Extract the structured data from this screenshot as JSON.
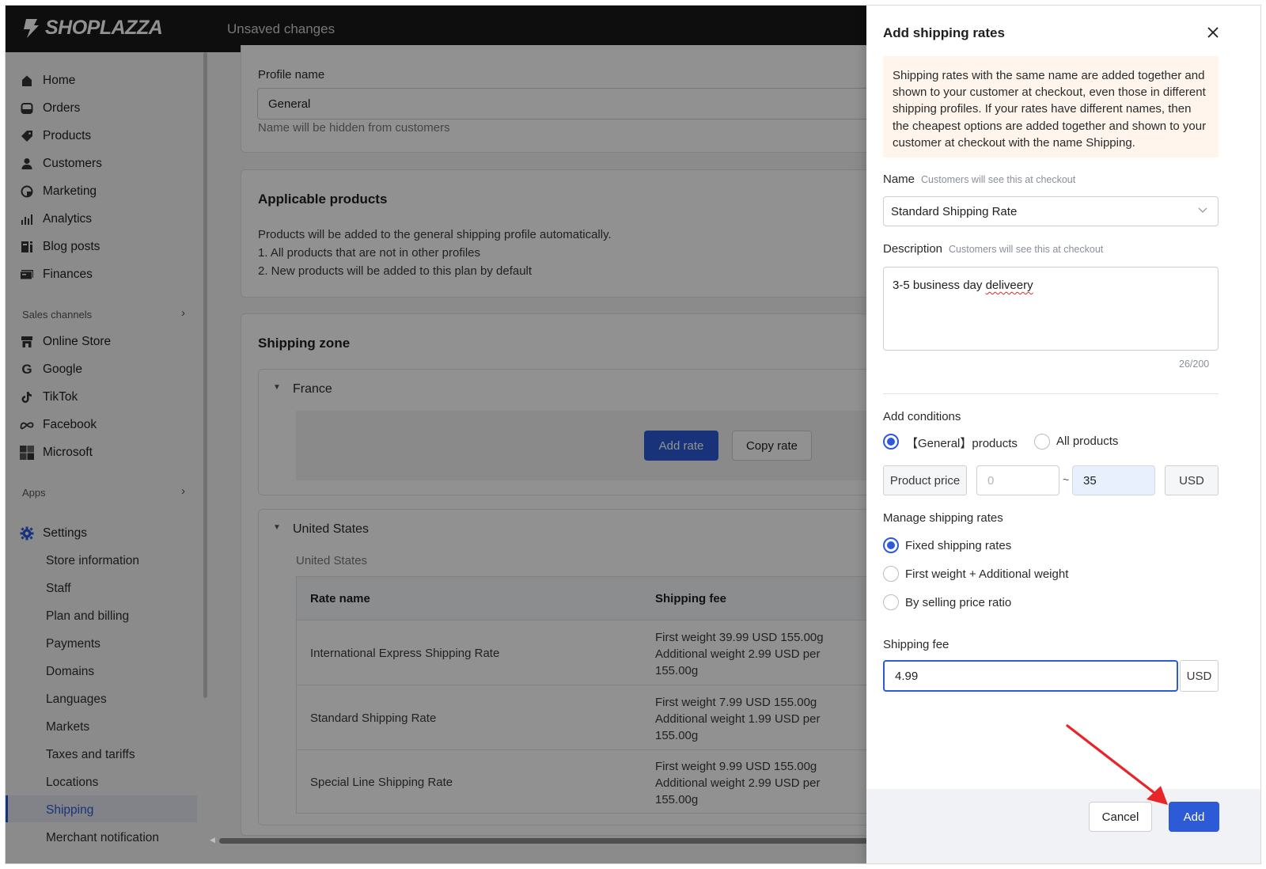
{
  "app": {
    "logo_text": "SHOPLAZZA",
    "status": "Unsaved changes"
  },
  "sidebar": {
    "items": [
      {
        "label": "Home",
        "icon": "home-icon"
      },
      {
        "label": "Orders",
        "icon": "orders-icon"
      },
      {
        "label": "Products",
        "icon": "tag-icon"
      },
      {
        "label": "Customers",
        "icon": "person-icon"
      },
      {
        "label": "Marketing",
        "icon": "marketing-icon"
      },
      {
        "label": "Analytics",
        "icon": "bar-chart-icon"
      },
      {
        "label": "Blog posts",
        "icon": "blog-icon"
      },
      {
        "label": "Finances",
        "icon": "finance-icon"
      }
    ],
    "sales_channels_label": "Sales channels",
    "channels": [
      {
        "label": "Online Store",
        "icon": "store-icon"
      },
      {
        "label": "Google",
        "icon": "google-icon"
      },
      {
        "label": "TikTok",
        "icon": "tiktok-icon"
      },
      {
        "label": "Facebook",
        "icon": "meta-icon"
      },
      {
        "label": "Microsoft",
        "icon": "microsoft-icon"
      }
    ],
    "apps_label": "Apps",
    "settings_label": "Settings",
    "settings_items": [
      "Store information",
      "Staff",
      "Plan and billing",
      "Payments",
      "Domains",
      "Languages",
      "Markets",
      "Taxes and tariffs",
      "Locations",
      "Shipping",
      "Merchant notification"
    ],
    "active_settings_item": "Shipping"
  },
  "main": {
    "profile_name_label": "Profile name",
    "profile_name_value": "General",
    "profile_name_help": "Name will be hidden from customers",
    "applicable_title": "Applicable products",
    "applicable_lines": [
      "Products will be added to the general shipping profile automatically.",
      "1. All products that are not in other profiles",
      "2. New products will be added to this plan by default"
    ],
    "shipping_zone_title": "Shipping zone",
    "zone_france": "France",
    "add_rate_label": "Add rate",
    "copy_rate_label": "Copy rate",
    "zone_us": "United States",
    "zone_us_sub": "United States",
    "table_headers": [
      "Rate name",
      "Shipping fee"
    ],
    "rates": [
      {
        "name": "International Express Shipping Rate",
        "fee": [
          "First weight 39.99 USD 155.00g",
          "Additional weight 2.99 USD per",
          "155.00g"
        ]
      },
      {
        "name": "Standard Shipping Rate",
        "fee": [
          "First weight 7.99 USD 155.00g",
          "Additional weight 1.99 USD per",
          "155.00g"
        ]
      },
      {
        "name": "Special Line Shipping Rate",
        "fee": [
          "First weight 9.99 USD 155.00g",
          "Additional weight 2.99 USD per",
          "155.00g"
        ]
      }
    ]
  },
  "drawer": {
    "title": "Add shipping rates",
    "notice": "Shipping rates with the same name are added together and shown to your customer at checkout, even those in different shipping profiles. If your rates have different names, then the cheapest options are added together and shown to your customer at checkout with the name Shipping.",
    "name_label": "Name",
    "name_hint": "Customers will see this at checkout",
    "name_value": "Standard Shipping Rate",
    "description_label": "Description",
    "description_hint": "Customers will see this at checkout",
    "description_value_prefix": "3-5 business day ",
    "description_value_misspelled": "deliveery",
    "description_count": "26/200",
    "conditions_label": "Add conditions",
    "condition_options": [
      "【General】products",
      "All products"
    ],
    "condition_selected": "【General】products",
    "product_price_label": "Product price",
    "price_min_placeholder": "0",
    "price_separator": "~",
    "price_max_value": "35",
    "price_currency": "USD",
    "manage_label": "Manage shipping rates",
    "manage_options": [
      "Fixed shipping rates",
      "First weight + Additional weight",
      "By selling price ratio"
    ],
    "manage_selected": "Fixed shipping rates",
    "fee_label": "Shipping fee",
    "fee_value": "4.99",
    "fee_currency": "USD",
    "cancel_label": "Cancel",
    "add_label": "Add"
  },
  "colors": {
    "accent": "#2d5bd7",
    "topbar": "#1a1a1a",
    "notice_bg": "#fff5ec",
    "annotation_arrow": "#e8262a"
  }
}
